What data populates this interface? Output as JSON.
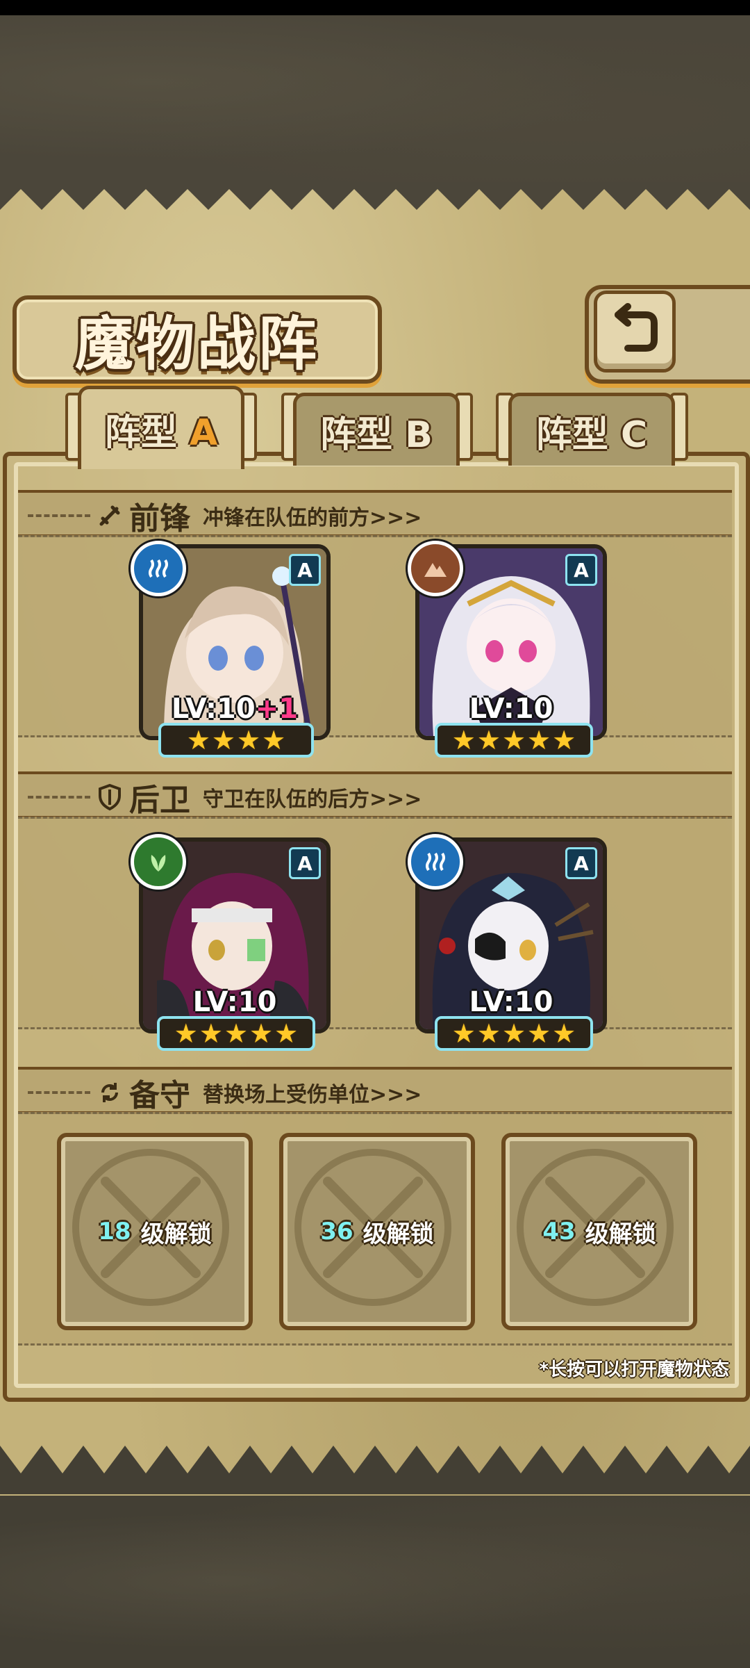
{
  "title": "魔物战阵",
  "tabs": [
    {
      "label": "阵型",
      "letter": "A",
      "active": true
    },
    {
      "label": "阵型",
      "letter": "B",
      "active": false
    },
    {
      "label": "阵型",
      "letter": "C",
      "active": false
    }
  ],
  "sections": {
    "front": {
      "title": "前锋",
      "desc": "冲锋在队伍的前方>>>",
      "icon": "sword-icon"
    },
    "back": {
      "title": "后卫",
      "desc": "守卫在队伍的后方>>>",
      "icon": "shield-icon"
    },
    "reserve": {
      "title": "备守",
      "desc": "替换场上受伤单位>>>",
      "icon": "swap-icon"
    }
  },
  "front_units": [
    {
      "level": "LV:10",
      "bonus": "+1",
      "stars": 4,
      "grade": "A",
      "element": "water-icon",
      "element_color": "#1e6fb8"
    },
    {
      "level": "LV:10",
      "bonus": "",
      "stars": 5,
      "grade": "A",
      "element": "earth-icon",
      "element_color": "#8a4a2a"
    }
  ],
  "back_units": [
    {
      "level": "LV:10",
      "bonus": "",
      "stars": 5,
      "grade": "A",
      "element": "leaf-icon",
      "element_color": "#2e7a2e"
    },
    {
      "level": "LV:10",
      "bonus": "",
      "stars": 5,
      "grade": "A",
      "element": "water-icon",
      "element_color": "#1e6fb8"
    }
  ],
  "reserve_slots": [
    {
      "unlock_level": "18",
      "unlock_text": "级解锁"
    },
    {
      "unlock_level": "36",
      "unlock_text": "级解锁"
    },
    {
      "unlock_level": "43",
      "unlock_text": "级解锁"
    }
  ],
  "hint": "*长按可以打开魔物状态",
  "accent": "#f0a02c"
}
